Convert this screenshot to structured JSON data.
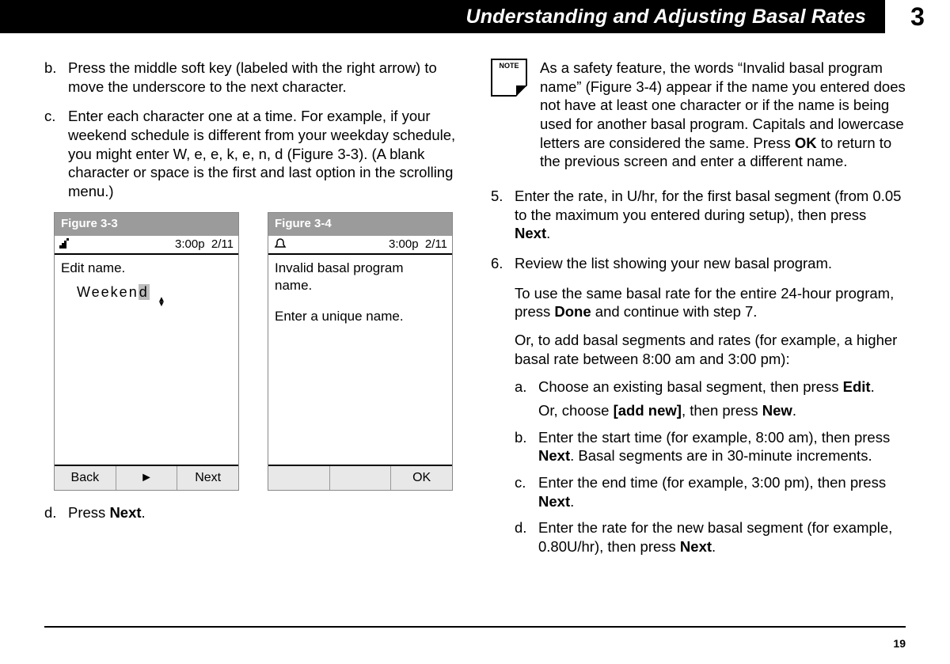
{
  "header": {
    "title": "Understanding and Adjusting Basal Rates",
    "chapter": "3"
  },
  "page_number": "19",
  "left": {
    "b_marker": "b.",
    "b_text": "Press the middle soft key (labeled with the right arrow) to move the underscore to the next character.",
    "c_marker": "c.",
    "c_text": "Enter each character one at a time. For example, if your weekend schedule is different from your weekday sched­ule, you might enter W, e, e, k, e, n, d (Figure 3-3). (A blank character or space is the first and last option in the scroll­ing menu.)",
    "d_marker": "d.",
    "d_text_prefix": "Press ",
    "d_text_bold": "Next",
    "d_text_suffix": "."
  },
  "fig33": {
    "caption": "Figure 3-3",
    "time": "3:00p",
    "date": "2/11",
    "line1": "Edit name.",
    "entry_prefix": "Weeken",
    "entry_hl": "d",
    "btn_left": "Back",
    "btn_mid": "►",
    "btn_right": "Next"
  },
  "fig34": {
    "caption": "Figure 3-4",
    "time": "3:00p",
    "date": "2/11",
    "line1": "Invalid basal program name.",
    "line2": "Enter a unique name.",
    "btn_right": "OK"
  },
  "note": {
    "label": "NOTE",
    "text_1": "As a safety feature, the words “Invalid basal program name” (Figure 3-4) appear if the name you entered does not have at least one character or if the name is being used for another basal program. Capitals and lowercase letters are considered the same. Press ",
    "text_bold": "OK",
    "text_2": " to return to the previous screen and enter a different name."
  },
  "right": {
    "s5_marker": "5.",
    "s5_a": "Enter the rate, in U/hr, for the first basal segment (from 0.05 to the maximum you entered during setup), then press ",
    "s5_b": "Next",
    "s5_c": ".",
    "s6_marker": "6.",
    "s6_txt": "Review the list showing your new basal program.",
    "p1_a": "To use the same basal rate for the entire 24-hour program, press ",
    "p1_b": "Done",
    "p1_c": " and continue with step 7.",
    "p2": "Or, to add basal segments and rates (for example, a higher basal rate between 8:00 am and 3:00 pm):",
    "a_marker": "a.",
    "a_1": "Choose an existing basal segment, then press ",
    "a_b": "Edit",
    "a_2": ".",
    "a_or_1": "Or, choose ",
    "a_or_b": "[add new]",
    "a_or_2": ", then press ",
    "a_or_b2": "New",
    "a_or_3": ".",
    "b_marker": "b.",
    "b_1": "Enter the start time (for example, 8:00 am), then press ",
    "b_b": "Next",
    "b_2": ". Basal segments are in 30-minute increments.",
    "c_marker": "c.",
    "c_1": "Enter the end time (for example, 3:00 pm), then press ",
    "c_b": "Next",
    "c_2": ".",
    "d_marker": "d.",
    "d_1": "Enter the rate for the new basal segment (for example, 0.80U/hr), then press ",
    "d_b": "Next",
    "d_2": "."
  }
}
